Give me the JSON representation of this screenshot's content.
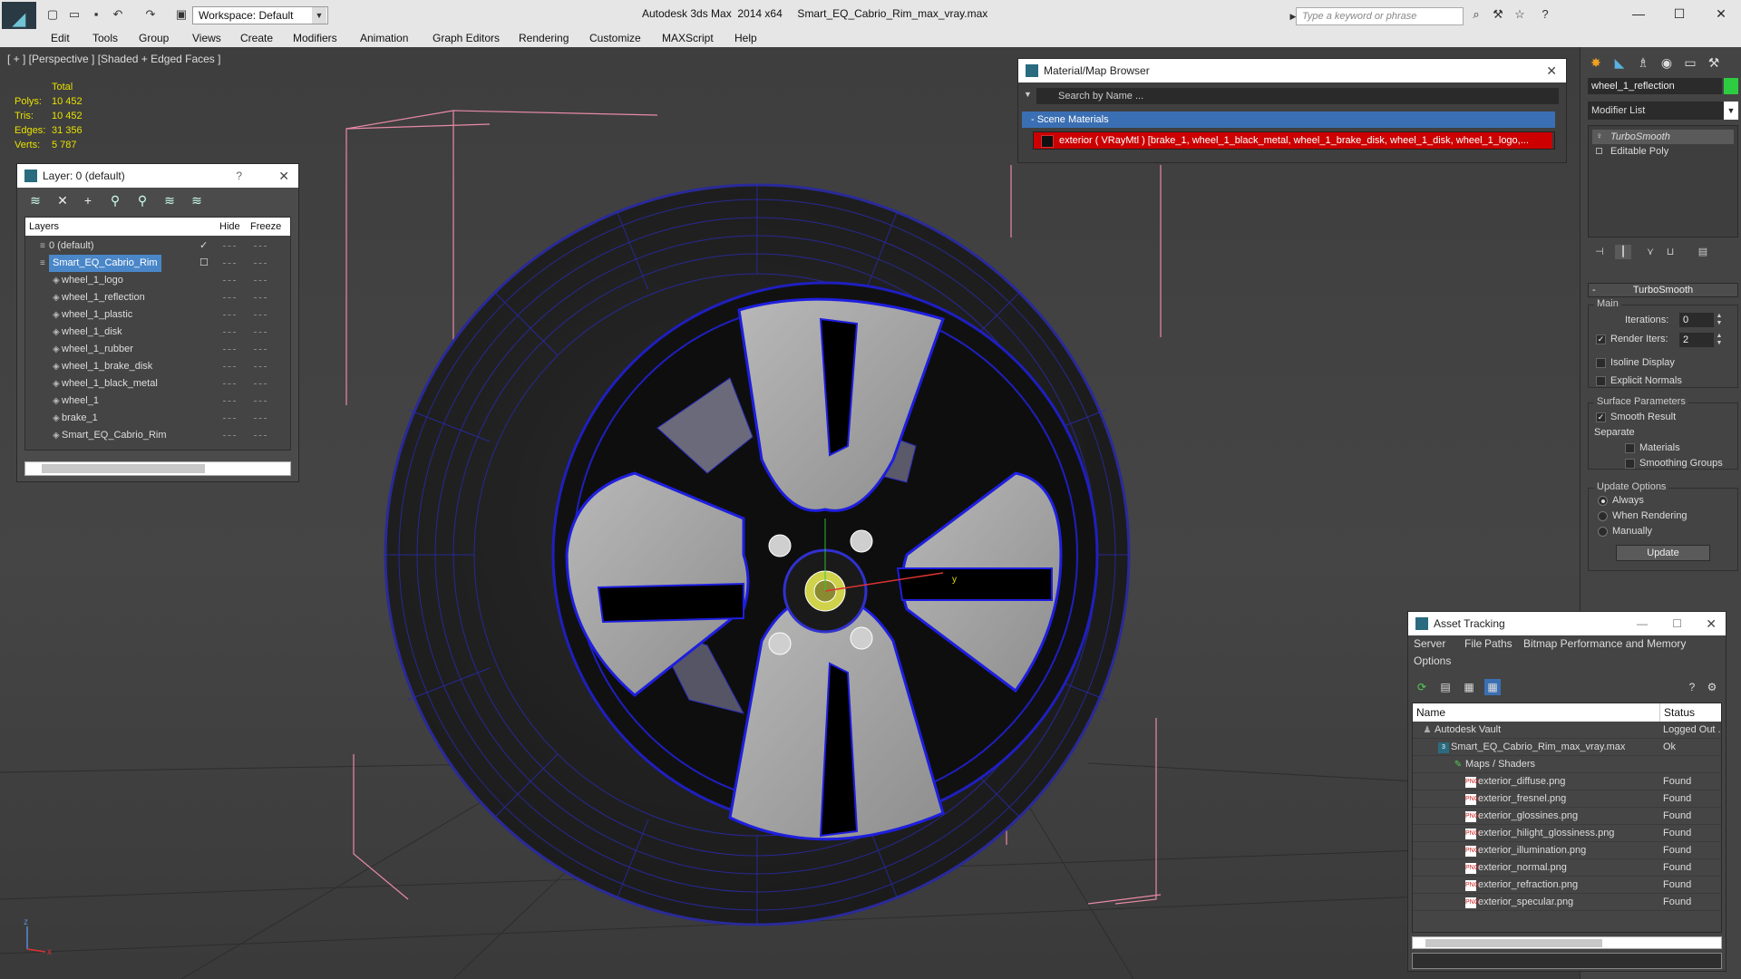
{
  "title_bar": {
    "app_title": "Autodesk 3ds Max  2014 x64     Smart_EQ_Cabrio_Rim_max_vray.max",
    "workspace": "Workspace: Default",
    "search_placeholder": "Type a keyword or phrase"
  },
  "menu": [
    "Edit",
    "Tools",
    "Group",
    "Views",
    "Create",
    "Modifiers",
    "Animation",
    "Graph Editors",
    "Rendering",
    "Customize",
    "MAXScript",
    "Help"
  ],
  "viewport": {
    "label": "[ + ] [Perspective ] [Shaded + Edged Faces ]",
    "stats": {
      "header": "Total",
      "polys_label": "Polys:",
      "polys": "10 452",
      "tris_label": "Tris:",
      "tris": "10 452",
      "edges_label": "Edges:",
      "edges": "31 356",
      "verts_label": "Verts:",
      "verts": "5 787"
    },
    "axis_y": "y",
    "axis_z": "z",
    "axis_x": "x"
  },
  "layer_panel": {
    "title": "Layer: 0 (default)",
    "help": "?",
    "columns": {
      "layers": "Layers",
      "hide": "Hide",
      "freeze": "Freeze"
    },
    "rows": [
      {
        "name": "0 (default)",
        "checked": true
      },
      {
        "name": "Smart_EQ_Cabrio_Rim",
        "selected": true
      },
      {
        "name": "wheel_1_logo"
      },
      {
        "name": "wheel_1_reflection"
      },
      {
        "name": "wheel_1_plastic"
      },
      {
        "name": "wheel_1_disk"
      },
      {
        "name": "wheel_1_rubber"
      },
      {
        "name": "wheel_1_brake_disk"
      },
      {
        "name": "wheel_1_black_metal"
      },
      {
        "name": "wheel_1"
      },
      {
        "name": "brake_1"
      },
      {
        "name": "Smart_EQ_Cabrio_Rim"
      }
    ]
  },
  "material_browser": {
    "title": "Material/Map Browser",
    "search_placeholder": "Search by Name ...",
    "group": "- Scene Materials",
    "item": "exterior  ( VRayMtl )  [brake_1, wheel_1_black_metal, wheel_1_brake_disk, wheel_1_disk, wheel_1_logo,..."
  },
  "command_panel": {
    "object_name": "wheel_1_reflection",
    "object_color": "#2ecc40",
    "modifier_list": "Modifier List",
    "stack": [
      "TurboSmooth",
      "Editable Poly"
    ],
    "turbosmooth": {
      "header": "TurboSmooth",
      "main": "Main",
      "iterations_label": "Iterations:",
      "iterations": "0",
      "render_iters_label": "Render Iters:",
      "render_iters": "2",
      "render_iters_checked": true,
      "isoline": "Isoline Display",
      "isoline_checked": false,
      "explicit": "Explicit Normals",
      "explicit_checked": false,
      "surface": "Surface Parameters",
      "smooth_result": "Smooth Result",
      "smooth_result_checked": true,
      "separate": "Separate",
      "materials": "Materials",
      "materials_checked": false,
      "smoothing_groups": "Smoothing Groups",
      "smoothing_groups_checked": false,
      "update_options": "Update Options",
      "always": "Always",
      "when_rendering": "When Rendering",
      "manually": "Manually",
      "selected_update_option": "Always",
      "update_button": "Update"
    }
  },
  "asset_tracking": {
    "title": "Asset Tracking",
    "menu": [
      "Server",
      "File",
      "Paths",
      "Bitmap Performance and Memory",
      "Options"
    ],
    "columns": {
      "name": "Name",
      "status": "Status"
    },
    "rows": [
      {
        "name": "Autodesk Vault",
        "status": "Logged Out ..."
      },
      {
        "name": "Smart_EQ_Cabrio_Rim_max_vray.max",
        "status": "Ok"
      },
      {
        "name": "Maps / Shaders",
        "status": ""
      },
      {
        "name": "exterior_diffuse.png",
        "status": "Found"
      },
      {
        "name": "exterior_fresnel.png",
        "status": "Found"
      },
      {
        "name": "exterior_glossines.png",
        "status": "Found"
      },
      {
        "name": "exterior_hilight_glossiness.png",
        "status": "Found"
      },
      {
        "name": "exterior_illumination.png",
        "status": "Found"
      },
      {
        "name": "exterior_normal.png",
        "status": "Found"
      },
      {
        "name": "exterior_refraction.png",
        "status": "Found"
      },
      {
        "name": "exterior_specular.png",
        "status": "Found"
      }
    ]
  }
}
